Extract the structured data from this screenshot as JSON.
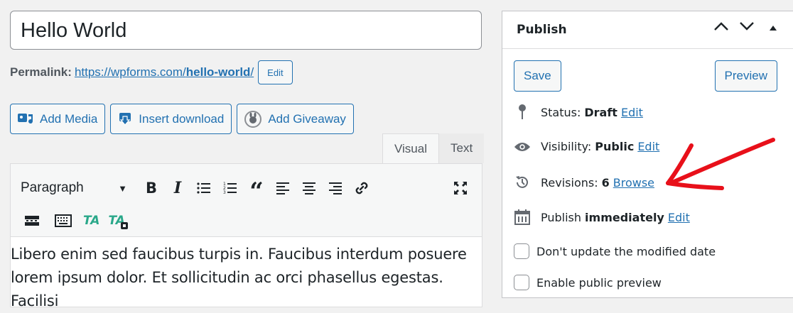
{
  "editor": {
    "title": "Hello World",
    "permalink_label": "Permalink:",
    "permalink_base": "https://wpforms.com/",
    "permalink_slug": "hello-world",
    "permalink_trail": "/",
    "permalink_edit": "Edit"
  },
  "media_buttons": {
    "add_media": "Add Media",
    "insert_download": "Insert download",
    "add_giveaway": "Add Giveaway"
  },
  "tabs": {
    "visual": "Visual",
    "text": "Text"
  },
  "toolbar": {
    "format_value": "Paragraph",
    "caret": "▼",
    "bold": "B",
    "italic": "I",
    "quote": "“",
    "ta1": "TA",
    "ta2": "TA"
  },
  "content": {
    "line1": "Libero enim sed faucibus turpis in. Faucibus interdum posuere",
    "line2": "lorem ipsum dolor. Et sollicitudin ac orci phasellus egestas. Facilisi"
  },
  "publish": {
    "title": "Publish",
    "save": "Save",
    "preview": "Preview",
    "status_label": "Status:",
    "status_value": "Draft",
    "status_edit": "Edit",
    "visibility_label": "Visibility:",
    "visibility_value": "Public",
    "visibility_edit": "Edit",
    "revisions_label": "Revisions:",
    "revisions_value": "6",
    "revisions_browse": "Browse",
    "publish_label": "Publish",
    "publish_value": "immediately",
    "publish_edit": "Edit",
    "dont_update": "Don't update the modified date",
    "public_preview": "Enable public preview"
  },
  "colors": {
    "accent": "#2271b1",
    "arrow": "#e8101a",
    "ta": "#2aa88a"
  }
}
